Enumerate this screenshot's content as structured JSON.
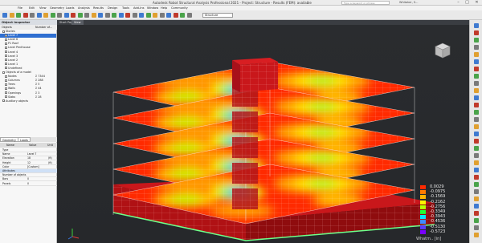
{
  "window": {
    "title": "Autodesk Robot Structural Analysis Professional 2021 - Project: Structure - Results (FEM): available",
    "search_placeholder": "Type a keyword or phrase",
    "user": "Whitaker, S...",
    "controls": [
      "–",
      "□",
      "✕"
    ]
  },
  "menu": {
    "items": [
      "File",
      "Edit",
      "View",
      "Geometry",
      "Loads",
      "Analysis",
      "Results",
      "Design",
      "Tools",
      "Add-Ins",
      "Window",
      "Help",
      "Community"
    ]
  },
  "toolbar": {
    "combo_value": "Structure",
    "icon_colors": [
      "#3f7ad0",
      "#e0a030",
      "#4aa34a",
      "#c03a2b",
      "#7a7a7a",
      "#3f7ad0",
      "#e0a030",
      "#4aa34a",
      "#7a7a7a",
      "#3f7ad0",
      "#c03a2b",
      "#4aa34a",
      "#7a7a7a",
      "#e0a030",
      "#3f7ad0",
      "#7a7a7a",
      "#4aa34a",
      "#3f7ad0",
      "#c03a2b",
      "#7a7a7a",
      "#3f7ad0",
      "#4aa34a",
      "#e0a030",
      "#7a7a7a",
      "#3f7ad0",
      "#c03a2b",
      "#4aa34a",
      "#7a7a7a"
    ]
  },
  "object_inspector": {
    "title": "Object Inspector",
    "columns": [
      "Objects",
      "Number of..."
    ],
    "rows": [
      {
        "label": "Stories",
        "value": "",
        "indent": 1
      },
      {
        "label": "Level 7",
        "value": "",
        "indent": 2,
        "selected": true
      },
      {
        "label": "Level 6",
        "value": "",
        "indent": 2
      },
      {
        "label": "P1 Roof",
        "value": "",
        "indent": 2
      },
      {
        "label": "Level Penthouse",
        "value": "",
        "indent": 2
      },
      {
        "label": "Level 4",
        "value": "",
        "indent": 2
      },
      {
        "label": "Level 3",
        "value": "",
        "indent": 2
      },
      {
        "label": "Level 2",
        "value": "",
        "indent": 2
      },
      {
        "label": "Level 1",
        "value": "",
        "indent": 2
      },
      {
        "label": "Undefined",
        "value": "",
        "indent": 2
      },
      {
        "label": "Objects of a model",
        "value": "",
        "indent": 1
      },
      {
        "label": "Nodes",
        "value": "Σ 7344",
        "indent": 2
      },
      {
        "label": "Columns",
        "value": "Σ 288",
        "indent": 2
      },
      {
        "label": "Trees",
        "value": "Σ 5",
        "indent": 2
      },
      {
        "label": "Walls",
        "value": "Σ 44",
        "indent": 2
      },
      {
        "label": "Openings",
        "value": "Σ 3",
        "indent": 2
      },
      {
        "label": "Slabs",
        "value": "Σ 28",
        "indent": 2
      },
      {
        "label": "Auxiliary objects",
        "value": "",
        "indent": 1
      }
    ]
  },
  "geometry_panel": {
    "tabs": [
      "Geometry",
      "Loads"
    ],
    "columns": [
      "Name",
      "Value",
      "Unit"
    ],
    "rows": [
      {
        "name": "Type",
        "value": "",
        "unit": ""
      },
      {
        "name": "Name",
        "value": "Level 7",
        "unit": ""
      },
      {
        "name": "Elevation",
        "value": "18",
        "unit": "(ft)"
      },
      {
        "name": "Height",
        "value": "12",
        "unit": "(ft)"
      },
      {
        "name": "Color",
        "value": "[Custom]",
        "unit": ""
      },
      {
        "name": "Attributes",
        "value": "",
        "unit": "",
        "selected": true
      },
      {
        "name": "Number of objects",
        "value": "",
        "unit": ""
      },
      {
        "name": "Bars",
        "value": "0",
        "unit": ""
      },
      {
        "name": "Panels",
        "value": "0",
        "unit": ""
      }
    ]
  },
  "viewport": {
    "tabs": [
      "Start Page",
      "View"
    ],
    "active_tab": 1
  },
  "legend": {
    "values": [
      "0.0029",
      "-0.0975",
      "-0.1569",
      "-0.2162",
      "-0.2756",
      "-0.3349",
      "-0.3943",
      "-0.4536",
      "-0.5130",
      "-0.5723"
    ],
    "colors": [
      "#ff2a00",
      "#ff7a00",
      "#ffb400",
      "#fff200",
      "#b6ff00",
      "#21ff2f",
      "#00e8ff",
      "#3f8cff",
      "#5a3cff",
      "#7a00ff"
    ],
    "caption": "Whatm.. [in]"
  }
}
